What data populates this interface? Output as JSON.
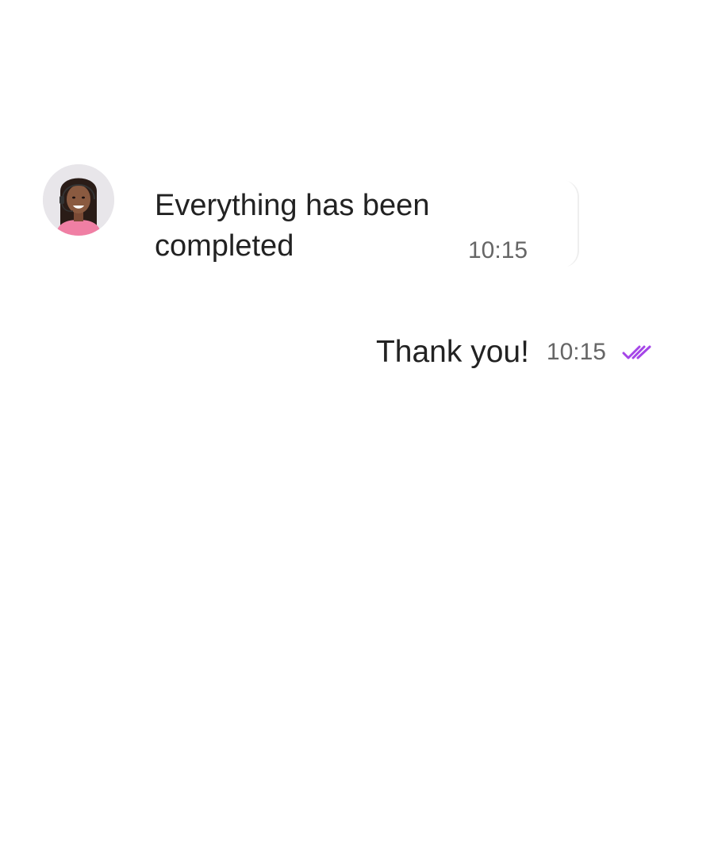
{
  "messages": {
    "incoming": {
      "text": "Everything has been completed",
      "time": "10:15",
      "avatar_icon": "agent-avatar"
    },
    "outgoing": {
      "text": "Thank you!",
      "time": "10:15",
      "status_icon": "double-check-icon",
      "status": "read"
    }
  },
  "colors": {
    "background": "#ffffff",
    "text": "#222222",
    "timestamp": "#666666",
    "read_check": "#a545e8"
  }
}
